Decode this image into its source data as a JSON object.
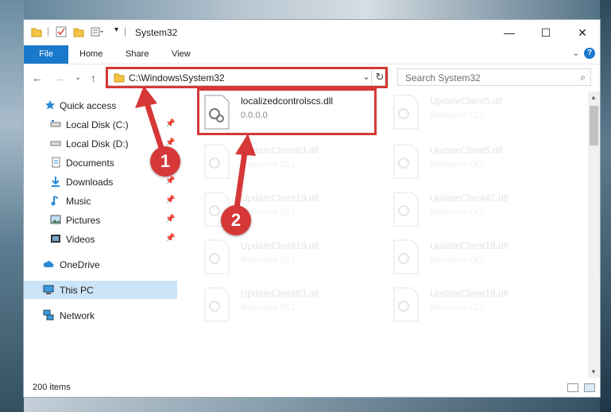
{
  "window": {
    "title": "System32",
    "minimize_icon": "minimize-icon",
    "maximize_icon": "maximize-icon",
    "close_icon": "close-icon"
  },
  "ribbon": {
    "file": "File",
    "tabs": [
      "Home",
      "Share",
      "View"
    ],
    "help_icon": "help-icon",
    "help_glyph": "?"
  },
  "nav": {
    "back_icon": "back-arrow-icon",
    "forward_icon": "forward-arrow-icon",
    "recent_icon": "chevron-down-icon",
    "up_icon": "up-arrow-icon"
  },
  "address": {
    "path": "C:\\Windows\\System32",
    "dropdown_icon": "chevron-down-icon",
    "refresh_icon": "refresh-icon"
  },
  "search": {
    "placeholder": "Search System32"
  },
  "sidebar": {
    "items": [
      {
        "label": "Quick access",
        "icon": "star-icon"
      },
      {
        "label": "Local Disk (C:)",
        "icon": "drive-icon",
        "pinned": true
      },
      {
        "label": "Local Disk (D:)",
        "icon": "drive-icon",
        "pinned": true
      },
      {
        "label": "Documents",
        "icon": "documents-icon",
        "pinned": true
      },
      {
        "label": "Downloads",
        "icon": "downloads-icon",
        "pinned": true
      },
      {
        "label": "Music",
        "icon": "music-icon",
        "pinned": true
      },
      {
        "label": "Pictures",
        "icon": "pictures-icon",
        "pinned": true
      },
      {
        "label": "Videos",
        "icon": "videos-icon",
        "pinned": true
      },
      {
        "label": "OneDrive",
        "icon": "cloud-icon"
      },
      {
        "label": "This PC",
        "icon": "computer-icon",
        "selected": true
      },
      {
        "label": "Network",
        "icon": "network-icon"
      }
    ]
  },
  "files": [
    {
      "name": "localizedcontrolscs.dll",
      "type": "0.0.0.0",
      "highlighted": true
    },
    {
      "name": "UpdateClient5.dll",
      "type": "Resource DLL"
    },
    {
      "name": "UpdateClient63.dll",
      "type": "Resource DLL"
    },
    {
      "name": "UpdateClient5.dll",
      "type": "Resource DLL"
    },
    {
      "name": "UpdateClient19.dll",
      "type": "Resource DLL"
    },
    {
      "name": "UpdateClient42.dll",
      "type": "Resource DLL"
    },
    {
      "name": "UpdateClient19.dll",
      "type": "Resource DLL"
    },
    {
      "name": "UpdateClient19.dll",
      "type": "Resource DLL"
    },
    {
      "name": "UpdateClient63.dll",
      "type": "Resource DLL"
    },
    {
      "name": "UpdateClient19.dll",
      "type": "Resource DLL"
    }
  ],
  "status": {
    "count": "200 items",
    "details_view_icon": "details-view-icon",
    "tiles_view_icon": "tiles-view-icon"
  },
  "callouts": [
    "1",
    "2"
  ],
  "colors": {
    "accent": "#1979ca",
    "highlight": "#d63838",
    "selection": "#cce4f7"
  }
}
